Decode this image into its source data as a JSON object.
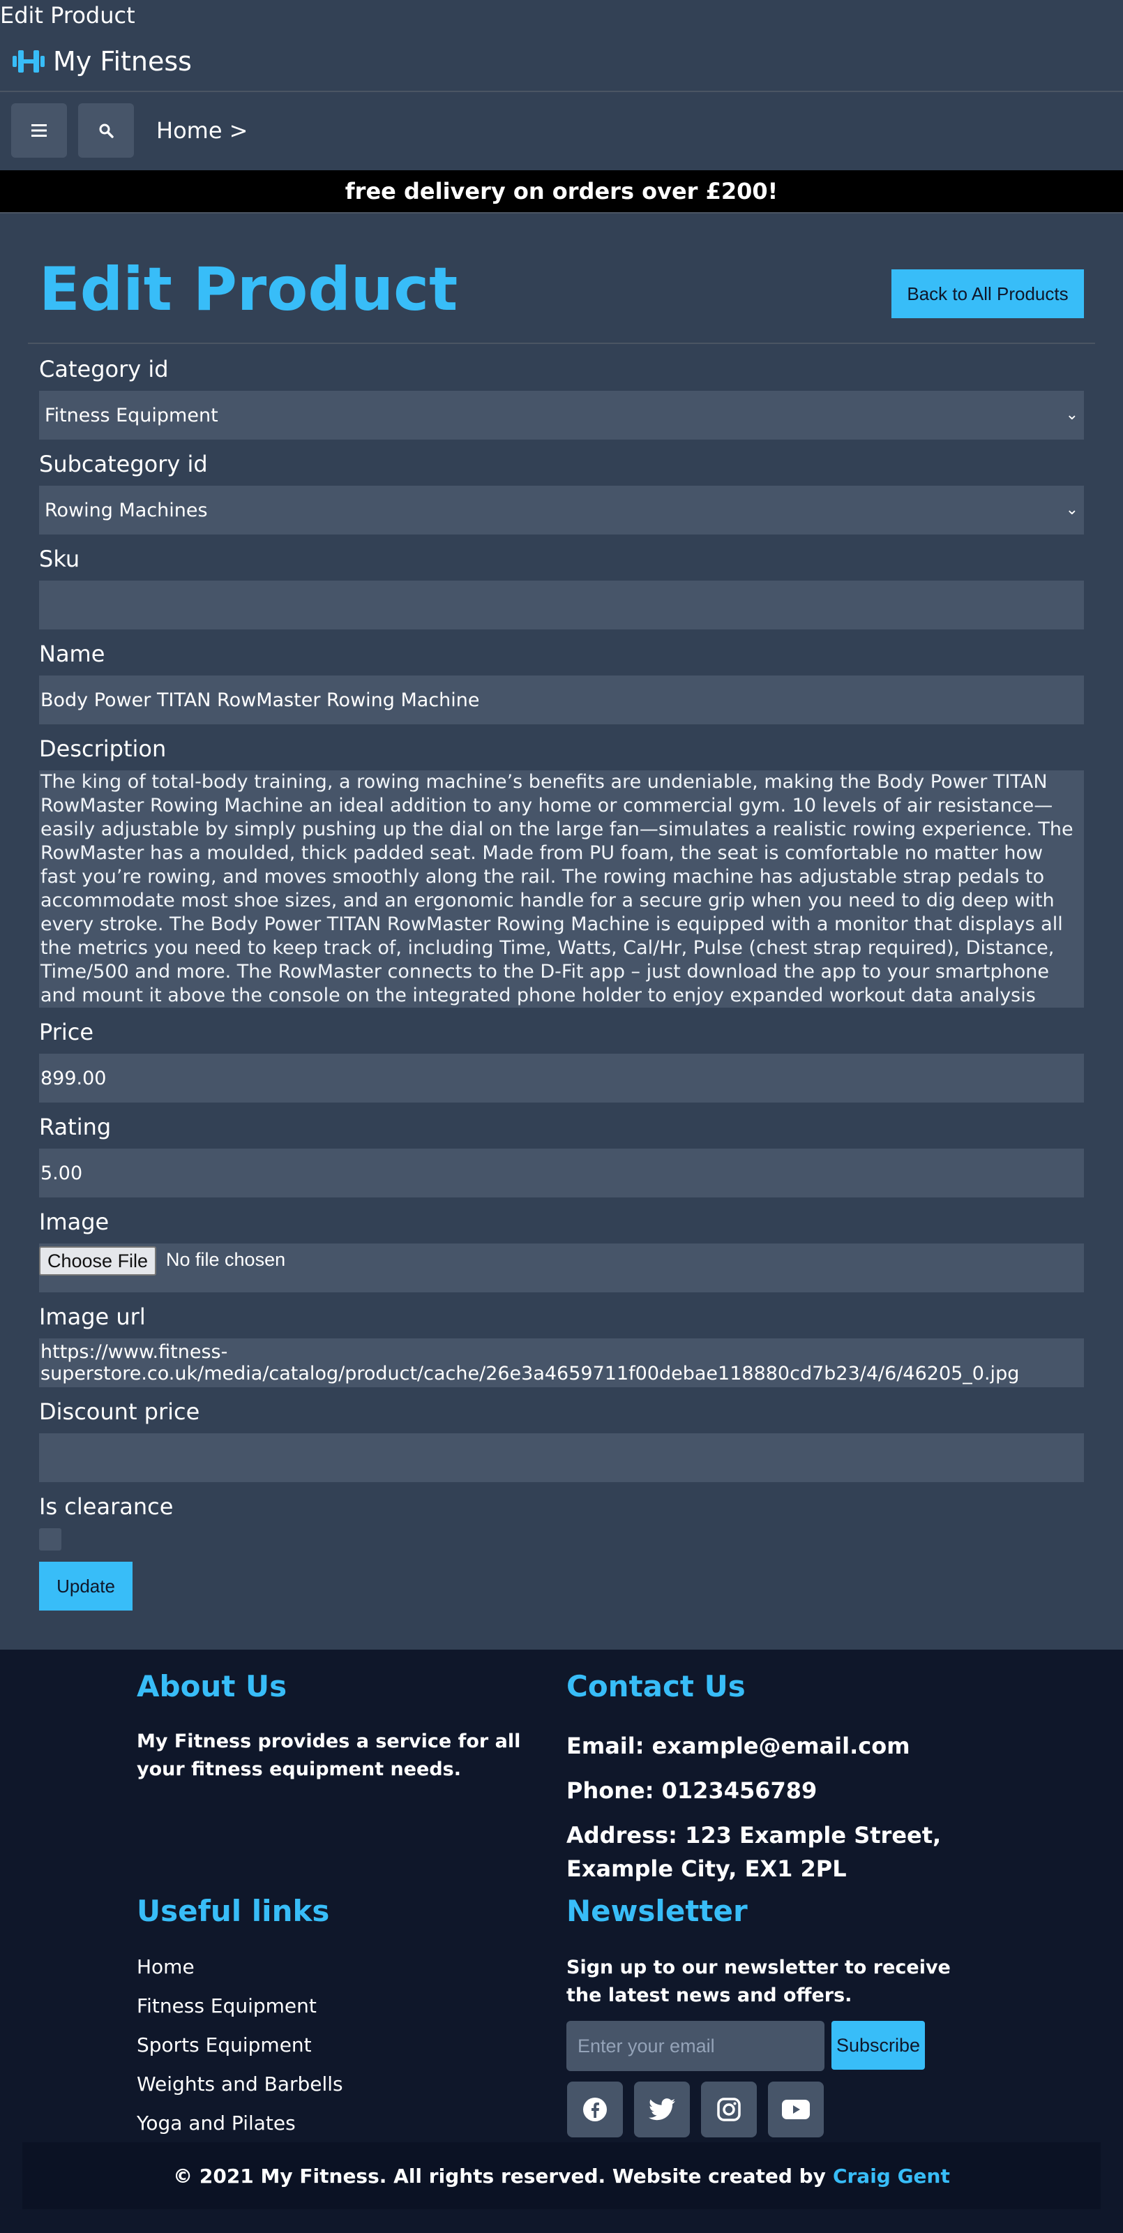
{
  "window": {
    "title": "Edit Product"
  },
  "brand": {
    "name": "My Fitness",
    "icon": "dumbbell-icon",
    "accent": "#38bdf8"
  },
  "nav": {
    "menu_icon": "hamburger-icon",
    "search_icon": "search-icon",
    "breadcrumb": "Home >"
  },
  "banner": {
    "text": "free delivery on orders over £200!"
  },
  "page": {
    "title": "Edit Product",
    "back_label": "Back to All Products"
  },
  "form": {
    "category": {
      "label": "Category id",
      "value": "Fitness Equipment"
    },
    "subcategory": {
      "label": "Subcategory id",
      "value": "Rowing Machines"
    },
    "sku": {
      "label": "Sku",
      "value": ""
    },
    "name": {
      "label": "Name",
      "value": "Body Power TITAN RowMaster Rowing Machine"
    },
    "description": {
      "label": "Description",
      "value": "The king of total-body training, a rowing machine’s benefits are undeniable, making the Body Power TITAN RowMaster Rowing Machine an ideal addition to any home or commercial gym. 10 levels of air resistance—easily adjustable by simply pushing up the dial on the large fan—simulates a realistic rowing experience. The RowMaster has a moulded, thick padded seat. Made from PU foam, the seat is comfortable no matter how fast you’re rowing, and moves smoothly along the rail. The rowing machine has adjustable strap pedals to accommodate most shoe sizes, and an ergonomic handle for a secure grip when you need to dig deep with every stroke. The Body Power TITAN RowMaster Rowing Machine is equipped with a monitor that displays all the metrics you need to keep track of, including Time, Watts, Cal/Hr, Pulse (chest strap required), Distance, Time/500 and more. The RowMaster connects to the D-Fit app – just download the app to your smartphone and mount it above the console on the integrated phone holder to enjoy expanded workout data analysis (app subscription may be required). The RowMaster has a pair of transport wheels integrated in to the front of the frame that make it easy to lift and"
    },
    "price": {
      "label": "Price",
      "value": "899.00"
    },
    "rating": {
      "label": "Rating",
      "value": "5.00"
    },
    "image": {
      "label": "Image",
      "button": "Choose File",
      "status": "No file chosen"
    },
    "image_url": {
      "label": "Image url",
      "value": "https://www.fitness-superstore.co.uk/media/catalog/product/cache/26e3a4659711f00debae118880cd7b23/4/6/46205_0.jpg"
    },
    "discount_price": {
      "label": "Discount price",
      "value": ""
    },
    "is_clearance": {
      "label": "Is clearance",
      "checked": false
    },
    "submit": "Update"
  },
  "footer": {
    "about": {
      "heading": "About Us",
      "text": "My Fitness provides a service for all your fitness equipment needs."
    },
    "contact": {
      "heading": "Contact Us",
      "email": "Email: example@email.com",
      "phone": "Phone: 0123456789",
      "address": "Address: 123 Example Street, Example City, EX1 2PL"
    },
    "links": {
      "heading": "Useful links",
      "items": [
        "Home",
        "Fitness Equipment",
        "Sports Equipment",
        "Weights and Barbells",
        "Yoga and Pilates"
      ]
    },
    "newsletter": {
      "heading": "Newsletter",
      "text": "Sign up to our newsletter to receive the latest news and offers.",
      "placeholder": "Enter your email",
      "button": "Subscribe"
    },
    "social": [
      "facebook-icon",
      "twitter-icon",
      "instagram-icon",
      "youtube-icon"
    ],
    "copyright": "© 2021 My Fitness. All rights reserved.  Website created by",
    "author": "Craig Gent"
  }
}
